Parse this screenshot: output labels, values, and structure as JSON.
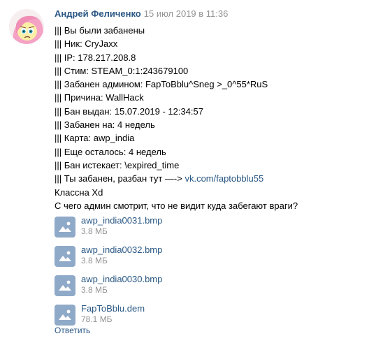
{
  "message": {
    "author": "Андрей Феличенко",
    "date": "15 июл 2019 в 11:36",
    "lines": [
      "||| Вы были забанены",
      "||| Ник: CryJaxx",
      "||| IP: 178.217.208.8",
      "||| Стим: STEAM_0:1:243679100",
      "||| Забанен админом: FapToBblu^Sneg >_0^55*RuS",
      "||| Причина: WallHack",
      "||| Бан выдан: 15.07.2019 - 12:34:57",
      "||| Забанен на: 4 недель",
      "||| Карта: awp_india",
      "||| Еще осталось: 4 недель",
      "||| Бан истекает: \\expired_time"
    ],
    "ban_line_prefix": "||| Ты забанен, разбан тут —-> ",
    "ban_link": "vk.com/faptobblu55",
    "after_lines": [
      "Классна Xd",
      "С чего админ смотрит, что не видит куда забегают враги?"
    ],
    "attachments": [
      {
        "name": "awp_india0031.bmp",
        "size": "3.8 МБ",
        "icon": "image-file-icon"
      },
      {
        "name": "awp_india0032.bmp",
        "size": "3.8 МБ",
        "icon": "image-file-icon"
      },
      {
        "name": "awp_india0030.bmp",
        "size": "3.8 МБ",
        "icon": "image-file-icon"
      },
      {
        "name": "FapToBblu.dem",
        "size": "78.1 МБ",
        "icon": "image-file-icon"
      }
    ],
    "reply_label": "Ответить"
  },
  "colors": {
    "link": "#2a5885",
    "muted": "#939393",
    "file_icon": "#8fa9c8"
  }
}
